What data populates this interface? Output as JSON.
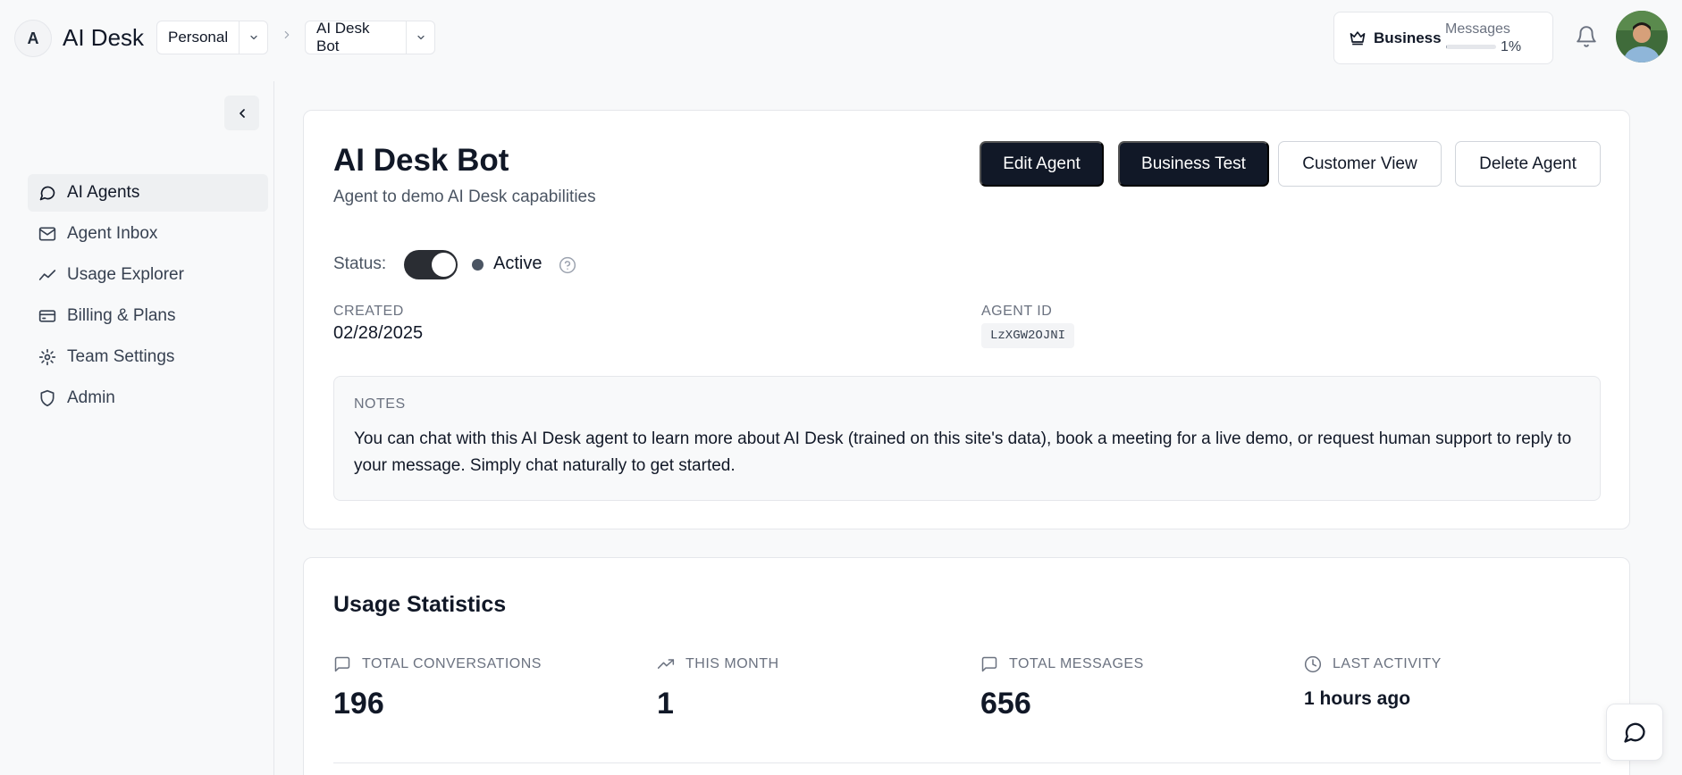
{
  "header": {
    "logo_letter": "A",
    "app_name": "AI Desk",
    "workspace_dropdown": "Personal",
    "agent_dropdown": "AI Desk Bot",
    "plan": {
      "name": "Business",
      "messages_label": "Messages",
      "usage_percent": "1%",
      "usage_fraction": 0.01
    }
  },
  "sidebar": {
    "items": [
      {
        "label": "AI Agents",
        "icon": "chat-bubble-icon",
        "active": true
      },
      {
        "label": "Agent Inbox",
        "icon": "mail-icon",
        "active": false
      },
      {
        "label": "Usage Explorer",
        "icon": "trend-icon",
        "active": false
      },
      {
        "label": "Billing & Plans",
        "icon": "credit-card-icon",
        "active": false
      },
      {
        "label": "Team Settings",
        "icon": "gear-icon",
        "active": false
      },
      {
        "label": "Admin",
        "icon": "shield-icon",
        "active": false
      }
    ]
  },
  "agent": {
    "title": "AI Desk Bot",
    "description": "Agent to demo AI Desk capabilities",
    "buttons": {
      "edit": "Edit Agent",
      "test": "Business Test",
      "customer": "Customer View",
      "delete": "Delete Agent"
    },
    "status_label": "Status:",
    "status_value": "Active",
    "created_label": "CREATED",
    "created_value": "02/28/2025",
    "agent_id_label": "AGENT ID",
    "agent_id_value": "LzXGW2OJNI",
    "notes_label": "NOTES",
    "notes_text": "You can chat with this AI Desk agent to learn more about AI Desk (trained on this site's data), book a meeting for a live demo, or request human support to reply to your message. Simply chat naturally to get started."
  },
  "usage": {
    "title": "Usage Statistics",
    "stats": [
      {
        "label": "TOTAL CONVERSATIONS",
        "value": "196",
        "icon": "message-square-icon"
      },
      {
        "label": "THIS MONTH",
        "value": "1",
        "icon": "trending-up-icon"
      },
      {
        "label": "TOTAL MESSAGES",
        "value": "656",
        "icon": "message-square-icon"
      },
      {
        "label": "LAST ACTIVITY",
        "value": "1 hours ago",
        "icon": "clock-icon"
      }
    ]
  },
  "colors": {
    "primary_dark": "#111827",
    "border": "#e5e7eb",
    "background": "#f8f9fa"
  }
}
